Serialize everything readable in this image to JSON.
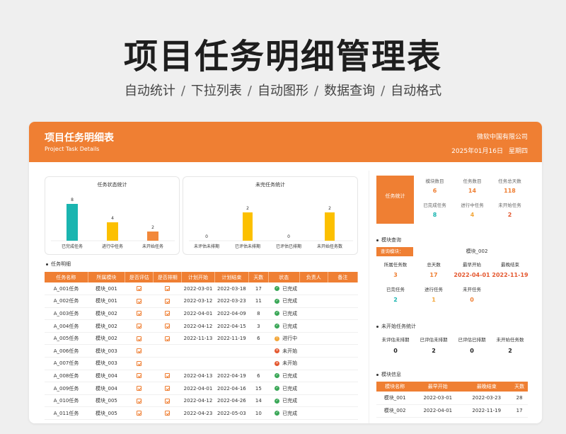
{
  "hero": {
    "title": "项目任务明细管理表",
    "features": [
      "自动统计",
      "下拉列表",
      "自动图形",
      "数据查询",
      "自动格式"
    ],
    "separator": "/"
  },
  "banner": {
    "title": "项目任务明细表",
    "subtitle": "Project Task Details",
    "company": "微软中国有限公司",
    "date": "2025年01月16日",
    "weekday": "星期四"
  },
  "colors": {
    "accent": "#ef7f33",
    "teal": "#1ab5b0",
    "gold": "#fcc000",
    "orange": "#f2883a",
    "done": "#3aa757",
    "progress": "#f3a73b",
    "notstarted": "#e4572e"
  },
  "chart_data": [
    {
      "type": "bar",
      "title": "任务状态统计",
      "categories": [
        "已完成任务",
        "进行中任务",
        "未开始任务"
      ],
      "values": [
        8,
        4,
        2
      ],
      "colors": [
        "#1ab5b0",
        "#fcc000",
        "#f2883a"
      ]
    },
    {
      "type": "bar",
      "title": "未完任务统计",
      "categories": [
        "未评估未排期",
        "已评估未排期",
        "已评估已排期",
        "未开始任务数"
      ],
      "values": [
        0,
        2,
        0,
        2
      ],
      "colors": [
        "#fcc000",
        "#fcc000",
        "#fcc000",
        "#fcc000"
      ]
    }
  ],
  "tasks": {
    "section_title": "任务明细",
    "headers": [
      "任务名称",
      "所属模块",
      "是否评估",
      "是否排期",
      "计划开始",
      "计划结束",
      "天数",
      "状态",
      "负责人",
      "备注"
    ],
    "rows": [
      {
        "name": "A_001任务",
        "module": "模块_001",
        "eval": true,
        "sched": true,
        "start": "2022-03-01",
        "end": "2022-03-18",
        "days": "17",
        "status": "已完成",
        "s": "done"
      },
      {
        "name": "A_002任务",
        "module": "模块_001",
        "eval": true,
        "sched": true,
        "start": "2022-03-12",
        "end": "2022-03-23",
        "days": "11",
        "status": "已完成",
        "s": "done"
      },
      {
        "name": "A_003任务",
        "module": "模块_002",
        "eval": true,
        "sched": true,
        "start": "2022-04-01",
        "end": "2022-04-09",
        "days": "8",
        "status": "已完成",
        "s": "done"
      },
      {
        "name": "A_004任务",
        "module": "模块_002",
        "eval": true,
        "sched": true,
        "start": "2022-04-12",
        "end": "2022-04-15",
        "days": "3",
        "status": "已完成",
        "s": "done"
      },
      {
        "name": "A_005任务",
        "module": "模块_002",
        "eval": true,
        "sched": true,
        "start": "2022-11-13",
        "end": "2022-11-19",
        "days": "6",
        "status": "进行中",
        "s": "prog"
      },
      {
        "name": "A_006任务",
        "module": "模块_003",
        "eval": true,
        "sched": false,
        "start": "",
        "end": "",
        "days": "",
        "status": "未开始",
        "s": "not"
      },
      {
        "name": "A_007任务",
        "module": "模块_003",
        "eval": true,
        "sched": false,
        "start": "",
        "end": "",
        "days": "",
        "status": "未开始",
        "s": "not"
      },
      {
        "name": "A_008任务",
        "module": "模块_004",
        "eval": true,
        "sched": true,
        "start": "2022-04-13",
        "end": "2022-04-19",
        "days": "6",
        "status": "已完成",
        "s": "done"
      },
      {
        "name": "A_009任务",
        "module": "模块_004",
        "eval": true,
        "sched": true,
        "start": "2022-04-01",
        "end": "2022-04-16",
        "days": "15",
        "status": "已完成",
        "s": "done"
      },
      {
        "name": "A_010任务",
        "module": "模块_005",
        "eval": true,
        "sched": true,
        "start": "2022-04-12",
        "end": "2022-04-26",
        "days": "14",
        "status": "已完成",
        "s": "done"
      },
      {
        "name": "A_011任务",
        "module": "模块_005",
        "eval": true,
        "sched": true,
        "start": "2022-04-23",
        "end": "2022-05-03",
        "days": "10",
        "status": "已完成",
        "s": "done"
      }
    ]
  },
  "summary": {
    "label": "任务统计",
    "cells": [
      {
        "label": "模块数目",
        "value": "6",
        "color": "#ef7f33"
      },
      {
        "label": "任务数目",
        "value": "14",
        "color": "#ef7f33"
      },
      {
        "label": "任务总天数",
        "value": "118",
        "color": "#ef7f33"
      },
      {
        "label": "已完成任务",
        "value": "8",
        "color": "#1ab5b0"
      },
      {
        "label": "进行中任务",
        "value": "4",
        "color": "#f3a73b"
      },
      {
        "label": "未开始任务",
        "value": "2",
        "color": "#e4572e"
      }
    ]
  },
  "query": {
    "section_title": "模块查询",
    "label": "查询模块：",
    "value": "模块_002",
    "row1": [
      {
        "label": "所属任务数",
        "value": "3",
        "color": "#ef7f33"
      },
      {
        "label": "总天数",
        "value": "17",
        "color": "#ef7f33"
      },
      {
        "label": "最早开始",
        "value": "2022-04-01",
        "color": "#e4572e"
      },
      {
        "label": "最晚结束",
        "value": "2022-11-19",
        "color": "#e4572e"
      }
    ],
    "row2": [
      {
        "label": "已完任务",
        "value": "2",
        "color": "#1ab5b0"
      },
      {
        "label": "进行任务",
        "value": "1",
        "color": "#f3a73b"
      },
      {
        "label": "未开任务",
        "value": "0",
        "color": "#ef7f33"
      }
    ]
  },
  "notstarted": {
    "section_title": "未开始任务统计",
    "cells": [
      {
        "label": "未评估未排期",
        "value": "0"
      },
      {
        "label": "已评估未排期",
        "value": "2"
      },
      {
        "label": "已评估已排期",
        "value": "0"
      },
      {
        "label": "未开始任务数",
        "value": "2"
      }
    ]
  },
  "modules": {
    "section_title": "模块信息",
    "headers": [
      "模块名称",
      "最早开始",
      "最晚结束",
      "天数"
    ],
    "rows": [
      [
        "模块_001",
        "2022-03-01",
        "2022-03-23",
        "28"
      ],
      [
        "模块_002",
        "2022-04-01",
        "2022-11-19",
        "17"
      ]
    ]
  }
}
